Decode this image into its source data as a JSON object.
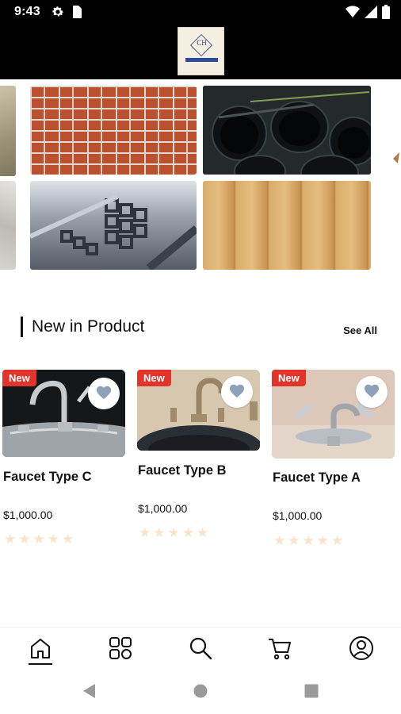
{
  "status_bar": {
    "time": "9:43",
    "left_icons": [
      "gear-icon",
      "sim-card-icon"
    ],
    "right_icons": [
      "wifi-icon",
      "cellular-signal-icon",
      "battery-icon"
    ]
  },
  "header": {
    "logo": {
      "initials": "CH"
    }
  },
  "banner": {
    "tiles": [
      {
        "name": "sand-image",
        "kind": "photo"
      },
      {
        "name": "brick-wall-image",
        "kind": "photo"
      },
      {
        "name": "black-pipes-image",
        "kind": "photo"
      },
      {
        "name": "gravel-image",
        "kind": "photo"
      },
      {
        "name": "steel-tubes-image",
        "kind": "photo"
      },
      {
        "name": "wood-planks-image",
        "kind": "photo"
      }
    ]
  },
  "section": {
    "title": "New in Product",
    "see_all": "See All"
  },
  "products": [
    {
      "badge": "New",
      "name": "Faucet Type C",
      "price": "$1,000.00",
      "rating": 0,
      "max_rating": 5
    },
    {
      "badge": "New",
      "name": "Faucet Type B",
      "price": "$1,000.00",
      "rating": 0,
      "max_rating": 5
    },
    {
      "badge": "New",
      "name": "Faucet Type A",
      "price": "$1,000.00",
      "rating": 0,
      "max_rating": 5
    }
  ],
  "bottom_nav": {
    "items": [
      "home-icon",
      "categories-icon",
      "search-icon",
      "cart-icon",
      "profile-icon"
    ],
    "active": "home-icon"
  },
  "system_nav": [
    "back-icon",
    "home-circle-icon",
    "recents-icon"
  ],
  "colors": {
    "badge": "#e3342b",
    "star_empty": "#fbe2c9",
    "header_bg": "#000000",
    "heart": "#8da2b8"
  }
}
